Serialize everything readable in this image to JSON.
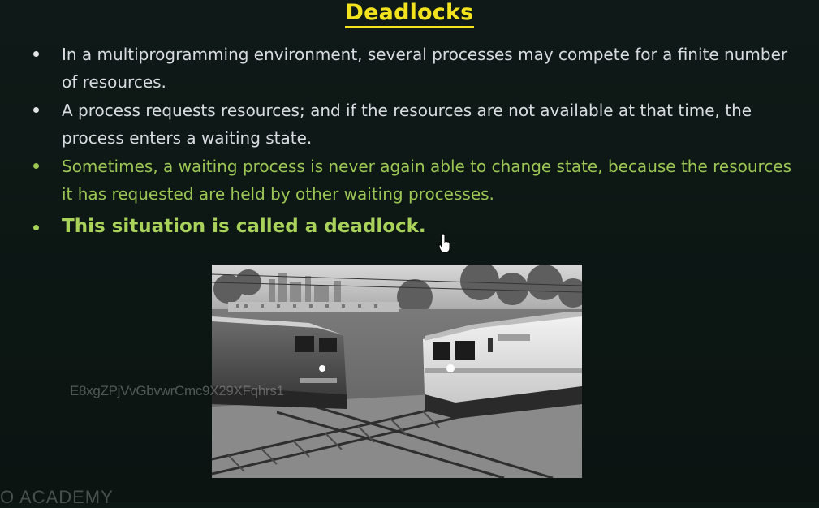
{
  "slide": {
    "title": "Deadlocks",
    "bullets": [
      "In a multiprogramming environment, several processes may compete for a finite number of resources.",
      "A process requests resources; and if the resources are not available at that time, the process enters a waiting state.",
      "Sometimes, a waiting process is never again able to change state, because the resources it has requested are held by other waiting processes.",
      "This situation is called a deadlock."
    ],
    "image_icon": "two-trains-on-crossing-tracks-image",
    "watermark": "E8xgZPjVvGbvwrCmc9X29XFqhrs1",
    "brand": "O ACADEMY"
  },
  "colors": {
    "background": "#0d1714",
    "title": "#f2e31e",
    "bullet_text": "#d9dcdf",
    "highlight_green": "#9bc653"
  }
}
